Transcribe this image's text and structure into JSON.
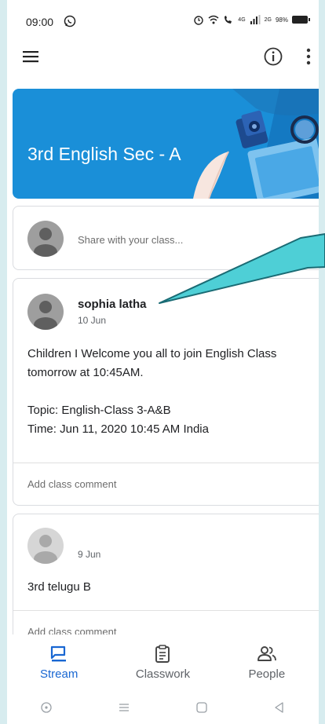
{
  "status_bar": {
    "time": "09:00",
    "net_4g": "4G",
    "net_2g": "2G",
    "battery": "98%"
  },
  "app_bar": {
    "icons": [
      "menu-icon",
      "info-icon",
      "more-vert-icon"
    ]
  },
  "banner": {
    "title": "3rd English Sec - A",
    "color": "#1a8fd8"
  },
  "share": {
    "placeholder": "Share with your class..."
  },
  "posts": [
    {
      "author": "sophia latha",
      "date": "10 Jun",
      "lines": [
        "Children I Welcome you all to join English Class tomorrow at 10:45AM.",
        "Topic: English-Class 3-A&B",
        "Time: Jun 11, 2020 10:45 AM India"
      ],
      "comment_label": "Add class comment"
    },
    {
      "author": "",
      "date": "9 Jun",
      "lines": [
        "3rd telugu B"
      ],
      "comment_label": "Add class comment"
    }
  ],
  "bottom_nav": {
    "items": [
      {
        "label": "Stream",
        "icon": "stream-icon",
        "active": true
      },
      {
        "label": "Classwork",
        "icon": "classwork-icon",
        "active": false
      },
      {
        "label": "People",
        "icon": "people-icon",
        "active": false
      }
    ],
    "active_color": "#1967d2"
  },
  "callout_color": "#4ecfd6"
}
